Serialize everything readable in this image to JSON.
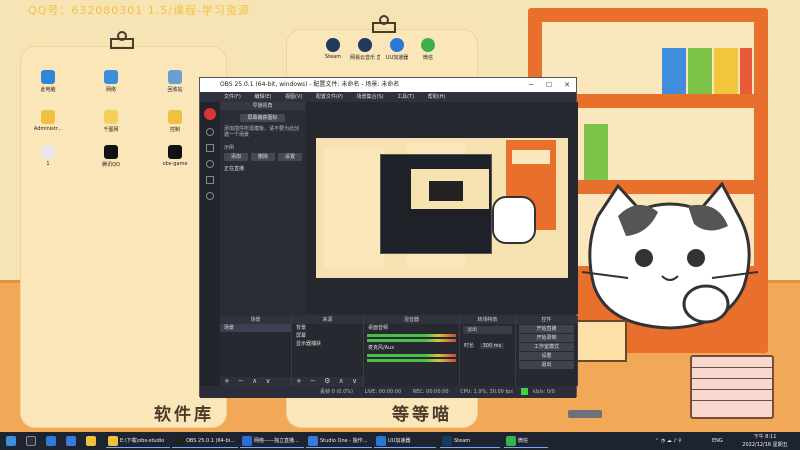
{
  "overlay_text": "QQ号：632080301    1.5/课程-学习资源",
  "left_board": {
    "title": "软件库",
    "icons": [
      {
        "label": "此电脑",
        "color": "#2f86d8"
      },
      {
        "label": "网络",
        "color": "#3b8fd8"
      },
      {
        "label": "回收站",
        "color": "#6a9fcf"
      },
      {
        "label": "Administr...",
        "color": "#f0c040"
      },
      {
        "label": "千图网",
        "color": "#f2d05a"
      },
      {
        "label": "控制",
        "color": "#f0c040"
      },
      {
        "label": "1",
        "color": "#e8e8e8"
      },
      {
        "label": "腾讯QQ",
        "color": "#111111"
      },
      {
        "label": "obs-game",
        "color": "#111111"
      }
    ]
  },
  "right_board": {
    "title": "等等喵",
    "icons": [
      {
        "label": "Steam",
        "color": "#1b3a5c"
      },
      {
        "label": "网易云音乐 直播助手",
        "color": "#203a5e"
      },
      {
        "label": "UU加速器",
        "color": "#2a78d4"
      },
      {
        "label": "微信",
        "color": "#3cb04a"
      }
    ]
  },
  "obs": {
    "title": "OBS 25.0.1 (64-bit, windows) - 配置文件: 未命名 - 场景: 未命名",
    "menu": [
      "文件(F)",
      "编辑(E)",
      "视图(V)",
      "配置文件(P)",
      "场景集合(S)",
      "工具(T)",
      "帮助(H)"
    ],
    "left_panel": {
      "header": "导播视角",
      "button_top": "屏幕捕获图标",
      "info_text": "添加插件所需模板，请不要为此创建一个场景",
      "label": "示例",
      "buttons": [
        "添加",
        "删除",
        "设置"
      ],
      "item": "正在直播"
    },
    "scenes_dock": {
      "header": "场景",
      "items": [
        "场景"
      ],
      "footer": "+ − ∧ ∨"
    },
    "sources_dock": {
      "header": "来源",
      "items": [
        "背景",
        "屏幕",
        "显示器捕获"
      ],
      "footer": "+ − ⚙ ∧ ∨"
    },
    "mixer_dock": {
      "header": "混音器",
      "items": [
        "桌面音频",
        "麦克风/Aux"
      ]
    },
    "transitions_dock": {
      "header": "转场特效",
      "type": "淡出",
      "duration_label": "时长",
      "duration_value": "300 ms"
    },
    "controls_dock": {
      "header": "控件",
      "buttons": [
        "开始直播",
        "开始录制",
        "工作室模式",
        "设置",
        "退出"
      ]
    },
    "status": {
      "dropped": "丢帧 0 (0.0%)",
      "live": "LIVE: 00:00:00",
      "rec": "REC: 00:00:00",
      "cpu": "CPU: 1.9%, 30.00 fps",
      "kbps": "kb/s: 0/0"
    }
  },
  "taskbar": {
    "apps": [
      {
        "label": "E:\\下载\\obs-studio",
        "color": "#f0c040"
      },
      {
        "label": "OBS 25.0.1 (64-bi...",
        "color": "#222222"
      },
      {
        "label": "网络——独立直播...",
        "color": "#2c6fd1"
      },
      {
        "label": "Studio One - 独作...",
        "color": "#3a7bd5"
      },
      {
        "label": "UU加速器",
        "color": "#2a78d4"
      },
      {
        "label": "Steam",
        "color": "#1b3a5c"
      },
      {
        "label": "微信",
        "color": "#3cb04a"
      }
    ],
    "lang": "ENG",
    "time": "下午 8:11",
    "date": "2022/12/16 星期五"
  },
  "colors": {
    "wall": "#f7e4b5",
    "floor": "#f1a957",
    "shelf": "#e8702c",
    "obs_bg": "#2b2e38",
    "accent_green": "#4bbd4b"
  }
}
